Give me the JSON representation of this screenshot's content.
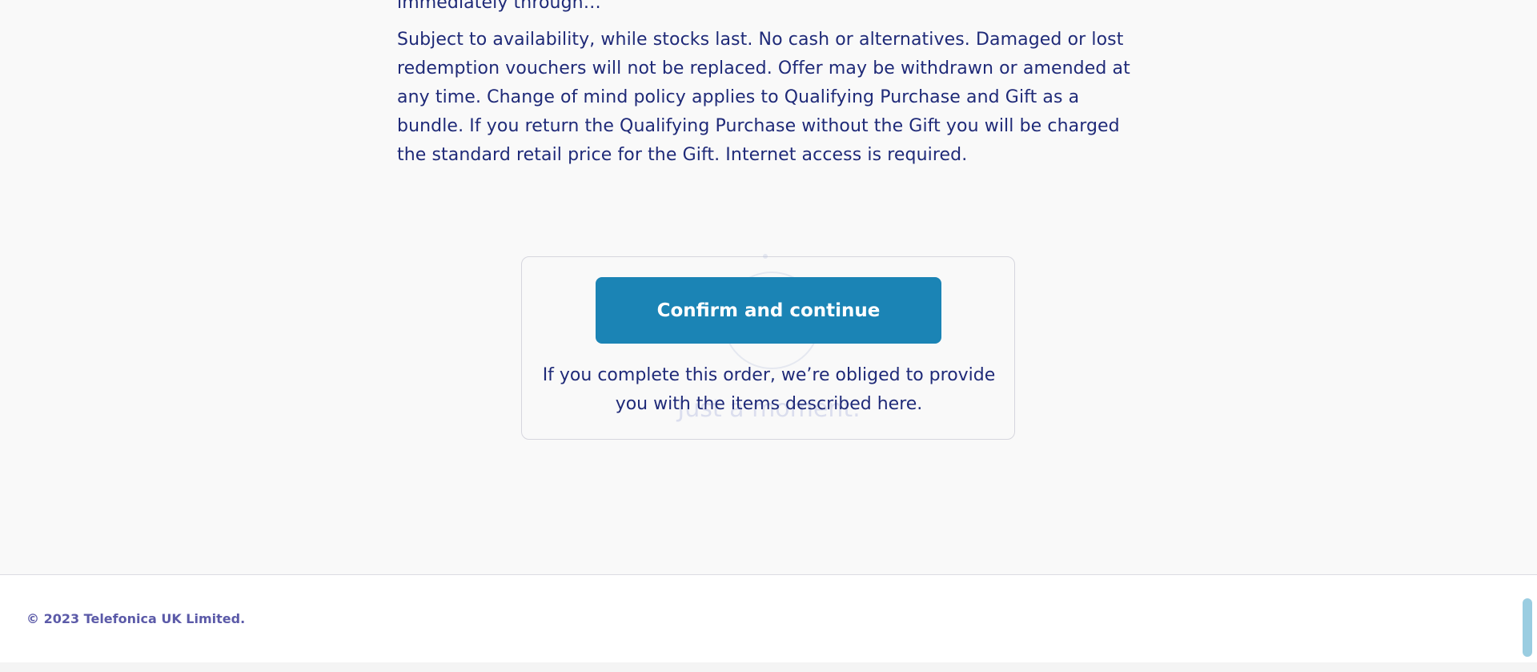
{
  "content": {
    "cut_line": "immediately through…",
    "terms_text": "Subject to availability, while stocks last. No cash or alternatives. Damaged or lost redemption vouchers will not be replaced. Offer may be withdrawn or amended at any time. Change of mind policy applies to Qualifying Purchase and Gift as a bundle. If you return the Qualifying Purchase without the Gift you will be charged the standard retail price for the Gift. Internet access is required."
  },
  "confirm": {
    "button_label": "Confirm and continue",
    "loading_text": "Just a moment.",
    "note": "If you complete this order, we’re obliged to provide you with the items described here."
  },
  "footer": {
    "copyright": "© 2023 Telefonica UK Limited."
  },
  "colors": {
    "primary_button": "#1b84b5",
    "text": "#1f2a78",
    "footer_text": "#5b5aa8",
    "scrollbar": "#9acde1"
  }
}
